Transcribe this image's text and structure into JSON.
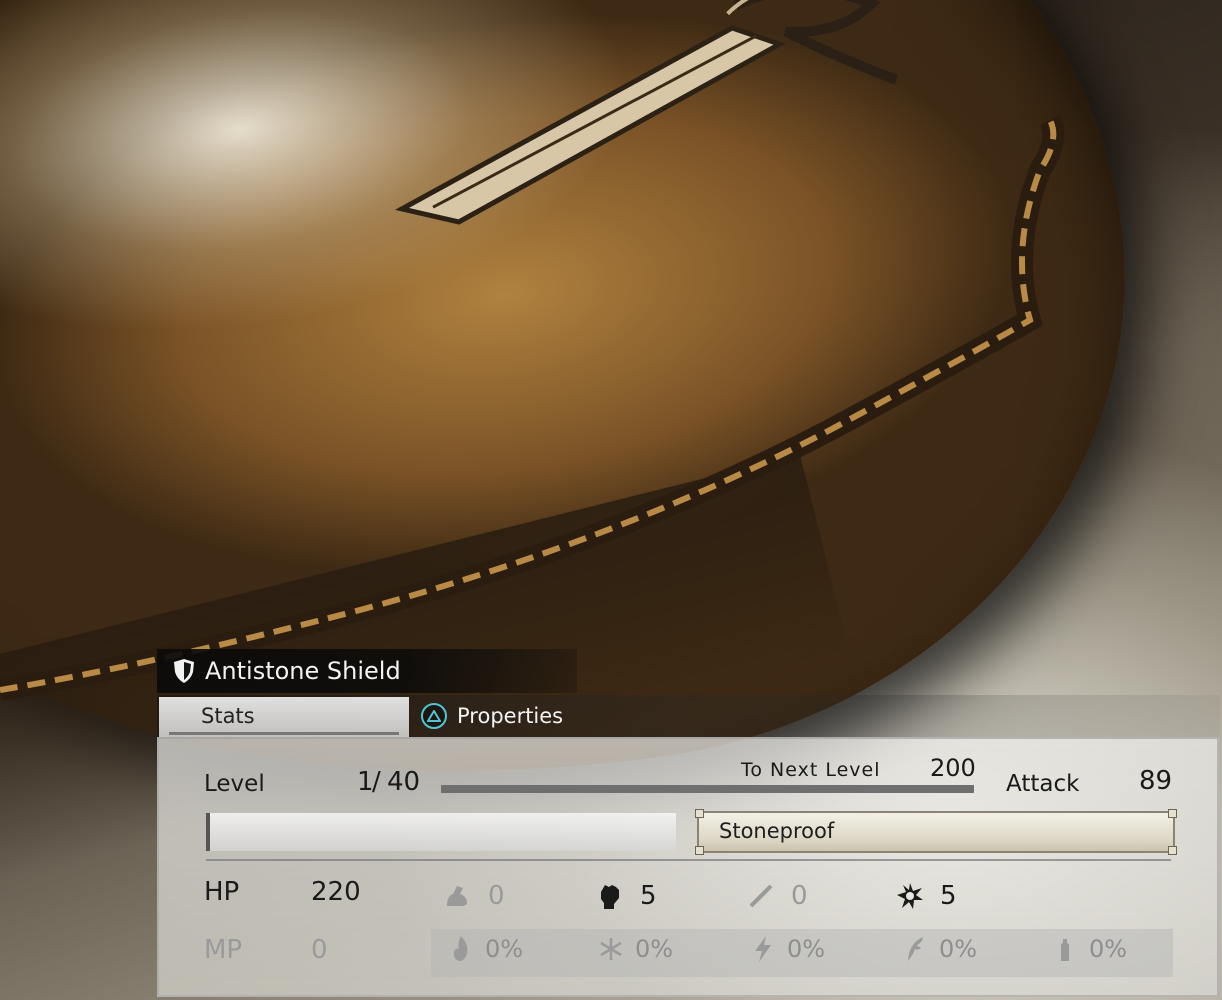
{
  "item": {
    "name": "Antistone Shield"
  },
  "tabs": {
    "stats": "Stats",
    "properties": "Properties"
  },
  "level": {
    "label": "Level",
    "current": "1",
    "max": "40",
    "separator": "/",
    "next_label": "To Next Level",
    "next_value": "200",
    "xp_progress": 0.0
  },
  "attack": {
    "label": "Attack",
    "value": "89"
  },
  "abilities": {
    "slot1": "",
    "slot2": "Stoneproof"
  },
  "hp": {
    "label": "HP",
    "value": "220"
  },
  "mp": {
    "label": "MP",
    "value": "0"
  },
  "attributes": [
    {
      "icon": "strength-arm-icon",
      "value": "0",
      "active": false
    },
    {
      "icon": "fist-icon",
      "value": "5",
      "active": true
    },
    {
      "icon": "slash-icon",
      "value": "0",
      "active": false
    },
    {
      "icon": "spirit-burst-icon",
      "value": "5",
      "active": true
    }
  ],
  "resistances": [
    {
      "icon": "fire-icon",
      "value": "0%"
    },
    {
      "icon": "ice-icon",
      "value": "0%"
    },
    {
      "icon": "lightning-icon",
      "value": "0%"
    },
    {
      "icon": "wind-icon",
      "value": "0%"
    },
    {
      "icon": "stone-icon",
      "value": "0%"
    }
  ],
  "colors": {
    "triangle": "#4fc6d6",
    "active_text": "#1a1a1a",
    "inactive_text": "#8e8e8e"
  }
}
